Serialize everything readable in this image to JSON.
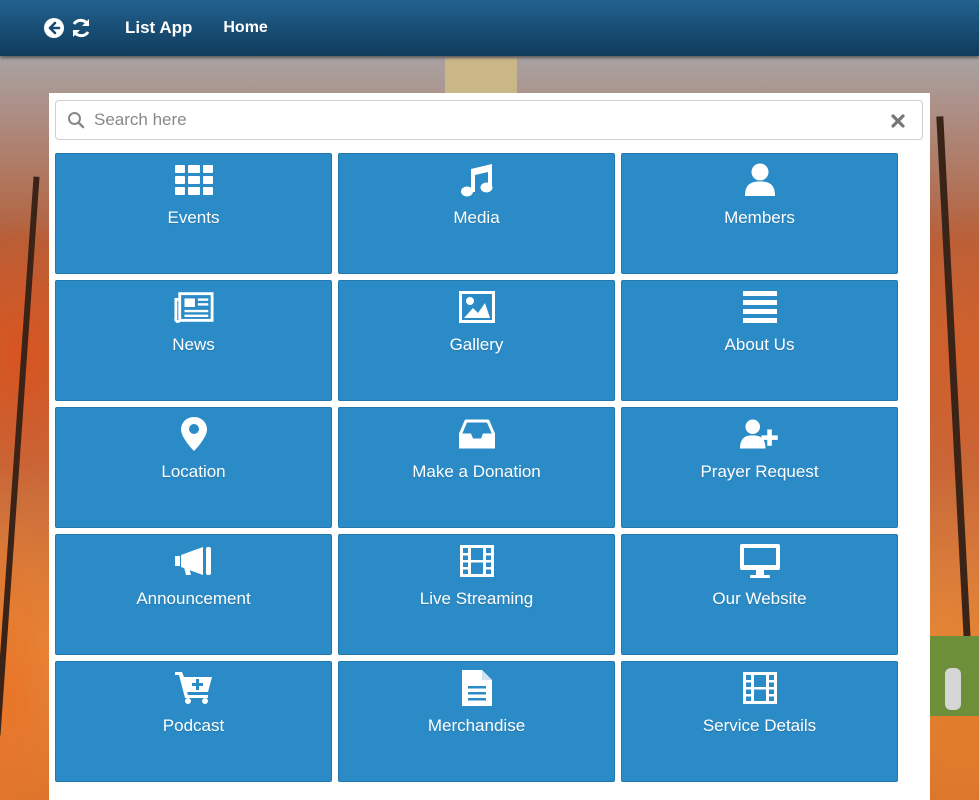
{
  "navbar": {
    "title": "List App",
    "home": "Home",
    "back_icon": "back-arrow-icon",
    "refresh_icon": "refresh-icon",
    "color": "#174a70"
  },
  "search": {
    "placeholder": "Search here",
    "value": ""
  },
  "tiles": [
    {
      "label": "Events",
      "icon": "grid-icon"
    },
    {
      "label": "Media",
      "icon": "music-note-icon"
    },
    {
      "label": "Members",
      "icon": "user-icon"
    },
    {
      "label": "News",
      "icon": "newspaper-icon"
    },
    {
      "label": "Gallery",
      "icon": "picture-icon"
    },
    {
      "label": "About Us",
      "icon": "list-icon"
    },
    {
      "label": "Location",
      "icon": "map-pin-icon"
    },
    {
      "label": "Make a Donation",
      "icon": "inbox-icon"
    },
    {
      "label": "Prayer Request",
      "icon": "user-plus-icon"
    },
    {
      "label": "Announcement",
      "icon": "megaphone-icon"
    },
    {
      "label": "Live Streaming",
      "icon": "film-icon"
    },
    {
      "label": "Our Website",
      "icon": "monitor-icon"
    },
    {
      "label": "Podcast",
      "icon": "cart-plus-icon"
    },
    {
      "label": "Merchandise",
      "icon": "document-icon"
    },
    {
      "label": "Service Details",
      "icon": "film-icon"
    }
  ],
  "colors": {
    "tile": "#2b8bc7",
    "tile_text": "#ffffff"
  }
}
